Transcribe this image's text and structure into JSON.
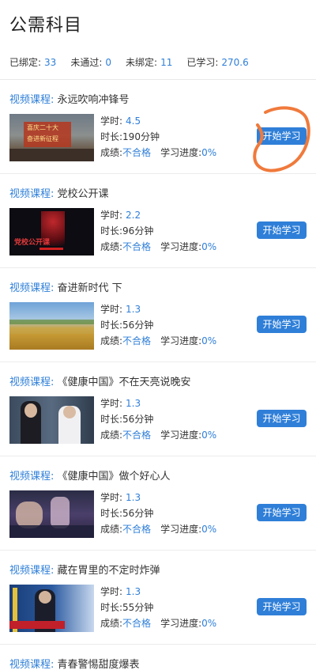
{
  "header": {
    "title": "公需科目"
  },
  "stats": [
    {
      "label": "已绑定:",
      "value": "33"
    },
    {
      "label": "未通过:",
      "value": "0"
    },
    {
      "label": "未绑定:",
      "value": "11"
    },
    {
      "label": "已学习:",
      "value": "270.6"
    }
  ],
  "labels": {
    "course_prefix": "视频课程:",
    "hours": "学时:",
    "duration": "时长:",
    "score": "成绩:",
    "progress": "学习进度:",
    "start_button": "开始学习"
  },
  "courses": [
    {
      "title": "永远吹响冲锋号",
      "hours": "4.5",
      "duration": "190分钟",
      "score": "不合格",
      "progress": "0%",
      "thumb_text": [
        "喜庆二十大",
        "奋进新征程"
      ]
    },
    {
      "title": "党校公开课",
      "hours": "2.2",
      "duration": "96分钟",
      "score": "不合格",
      "progress": "0%",
      "thumb_text": [
        "党校公开课"
      ]
    },
    {
      "title": "奋进新时代 下",
      "hours": "1.3",
      "duration": "56分钟",
      "score": "不合格",
      "progress": "0%",
      "thumb_text": []
    },
    {
      "title": "《健康中国》不在天亮说晚安",
      "hours": "1.3",
      "duration": "56分钟",
      "score": "不合格",
      "progress": "0%",
      "thumb_text": []
    },
    {
      "title": "《健康中国》做个好心人",
      "hours": "1.3",
      "duration": "56分钟",
      "score": "不合格",
      "progress": "0%",
      "thumb_text": []
    },
    {
      "title": "藏在胃里的不定时炸弹",
      "hours": "1.3",
      "duration": "55分钟",
      "score": "不合格",
      "progress": "0%",
      "thumb_text": []
    },
    {
      "title": "青春警惕甜度爆表"
    }
  ]
}
